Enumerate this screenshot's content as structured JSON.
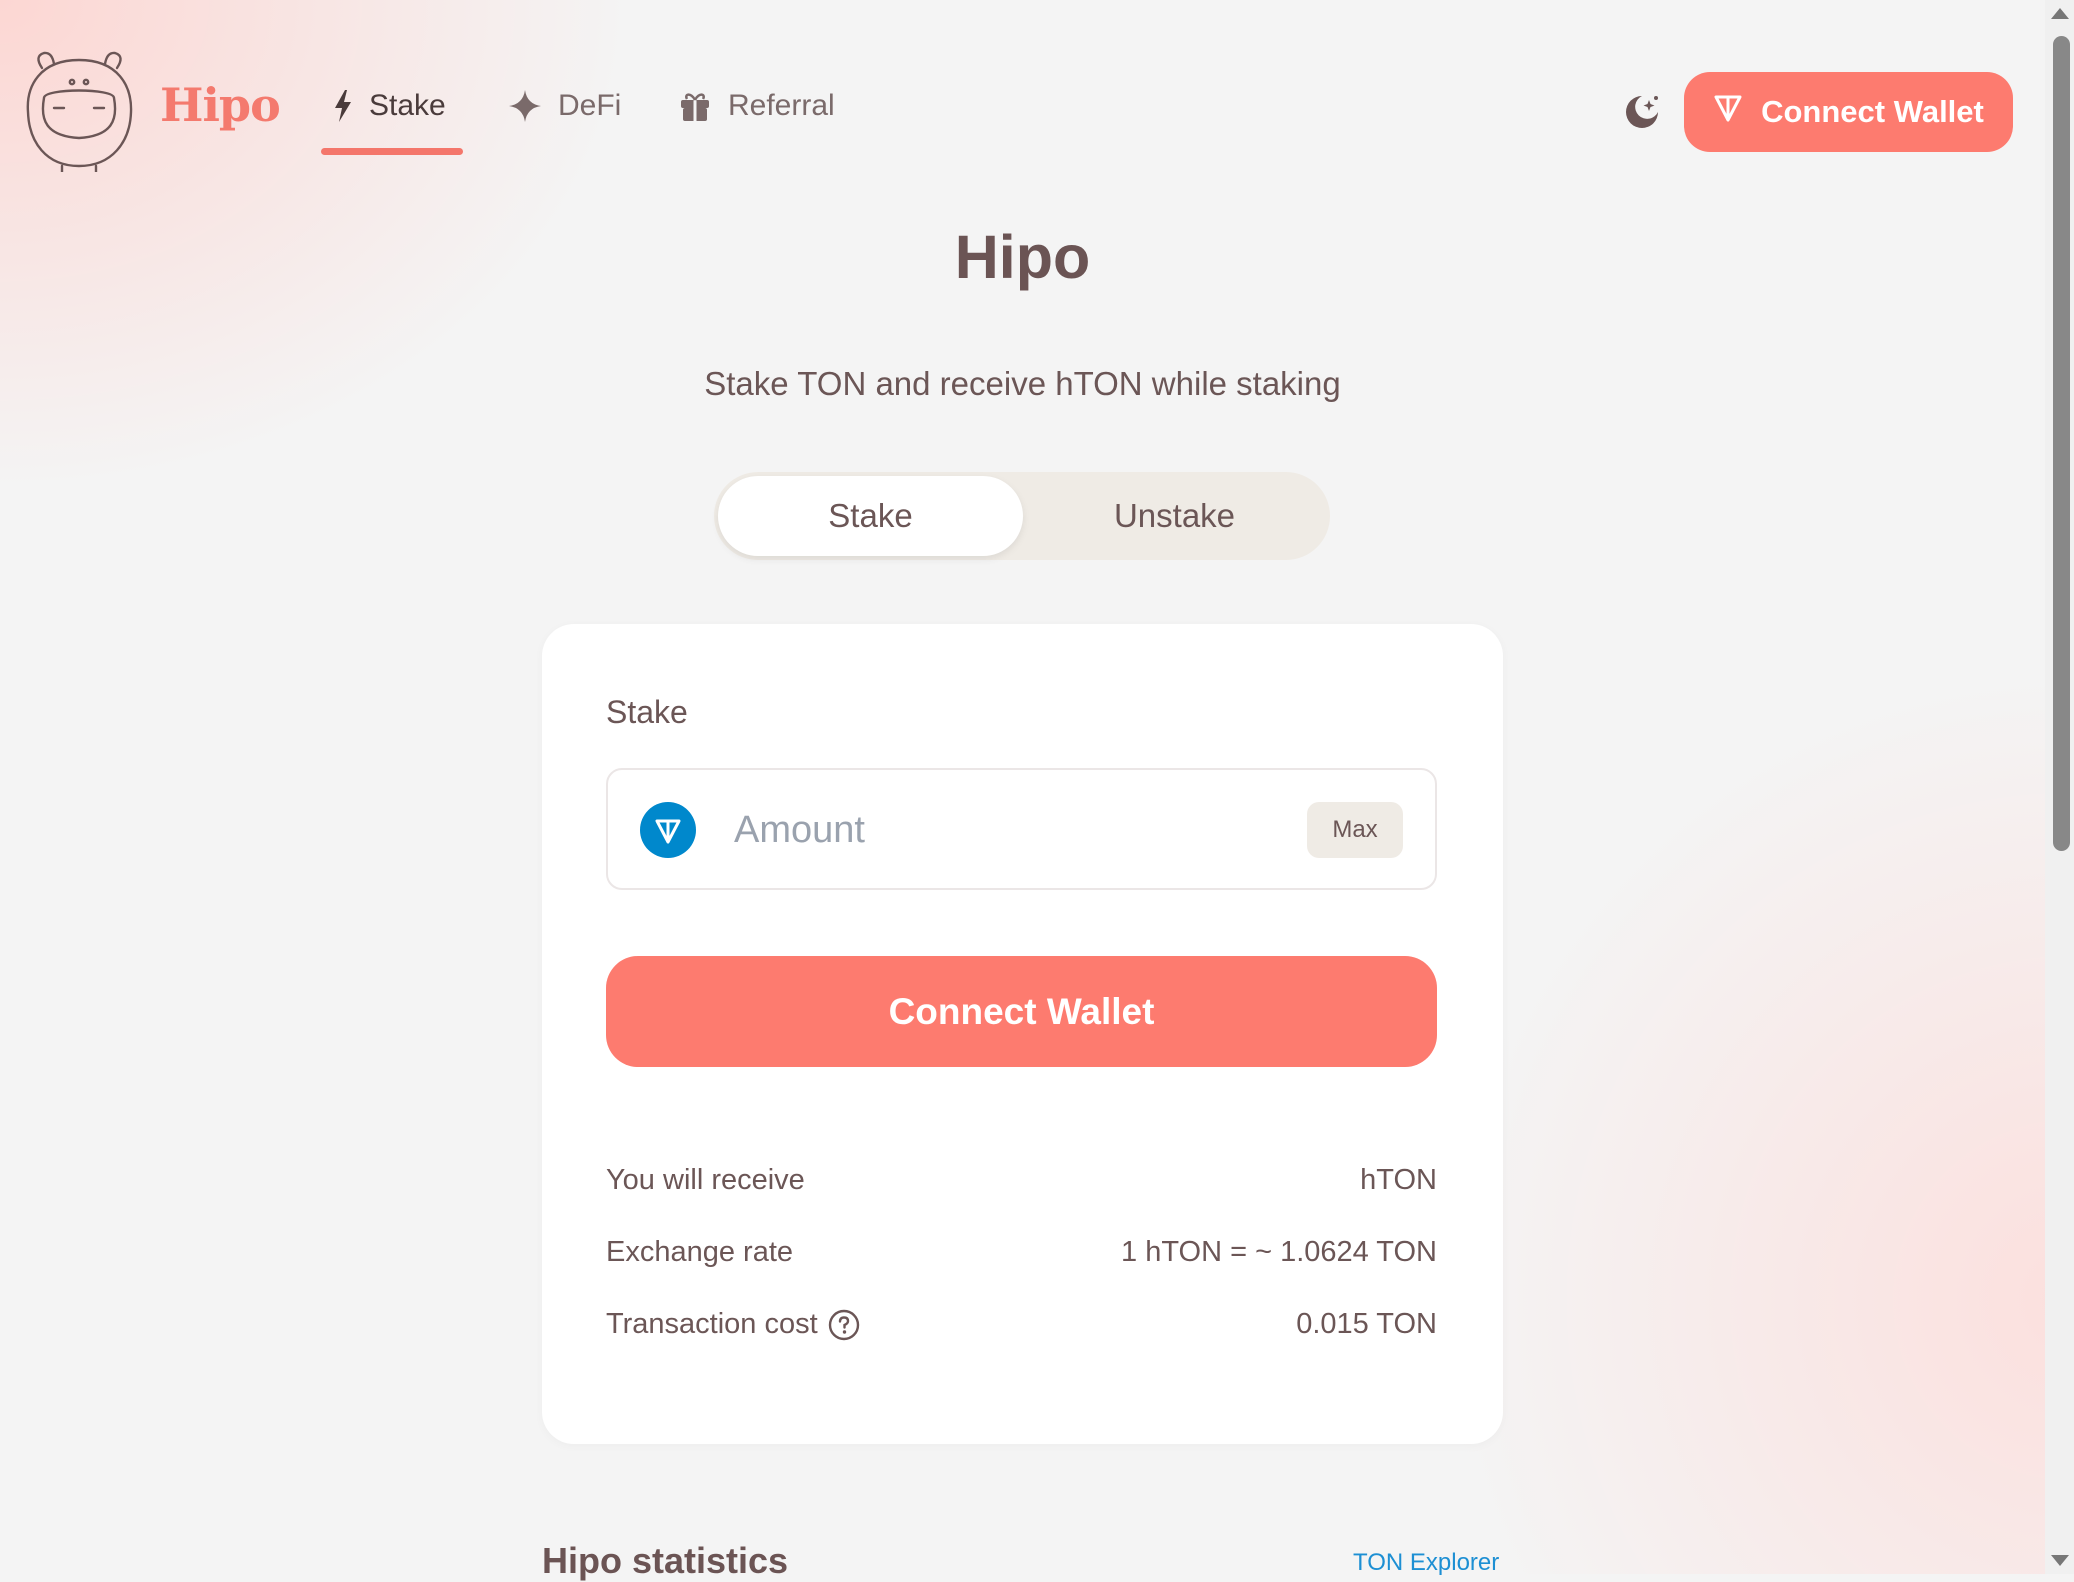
{
  "header": {
    "brand": "Hipo",
    "nav": [
      {
        "label": "Stake",
        "icon": "lightning-icon",
        "active": true
      },
      {
        "label": "DeFi",
        "icon": "sparkle-icon",
        "active": false
      },
      {
        "label": "Referral",
        "icon": "gift-icon",
        "active": false
      }
    ],
    "theme_toggle_icon": "moon-stars-icon",
    "connect_label": "Connect Wallet"
  },
  "hero": {
    "title": "Hipo",
    "subtitle": "Stake TON and receive hTON while staking"
  },
  "tabs": [
    {
      "label": "Stake",
      "selected": true
    },
    {
      "label": "Unstake",
      "selected": false
    }
  ],
  "card": {
    "label": "Stake",
    "amount_placeholder": "Amount",
    "amount_value": "",
    "max_label": "Max",
    "connect_label": "Connect Wallet",
    "rows": [
      {
        "label": "You will receive",
        "value": "hTON"
      },
      {
        "label": "Exchange rate",
        "value": "1 hTON = ~ 1.0624 TON"
      },
      {
        "label": "Transaction cost",
        "value": "0.015 TON"
      }
    ]
  },
  "stats": {
    "title": "Hipo statistics",
    "explorer_link": "TON Explorer"
  },
  "colors": {
    "accent": "#fd7b6f",
    "ton_blue": "#0088cc",
    "text": "#6b5656",
    "link": "#1d8fd3"
  }
}
